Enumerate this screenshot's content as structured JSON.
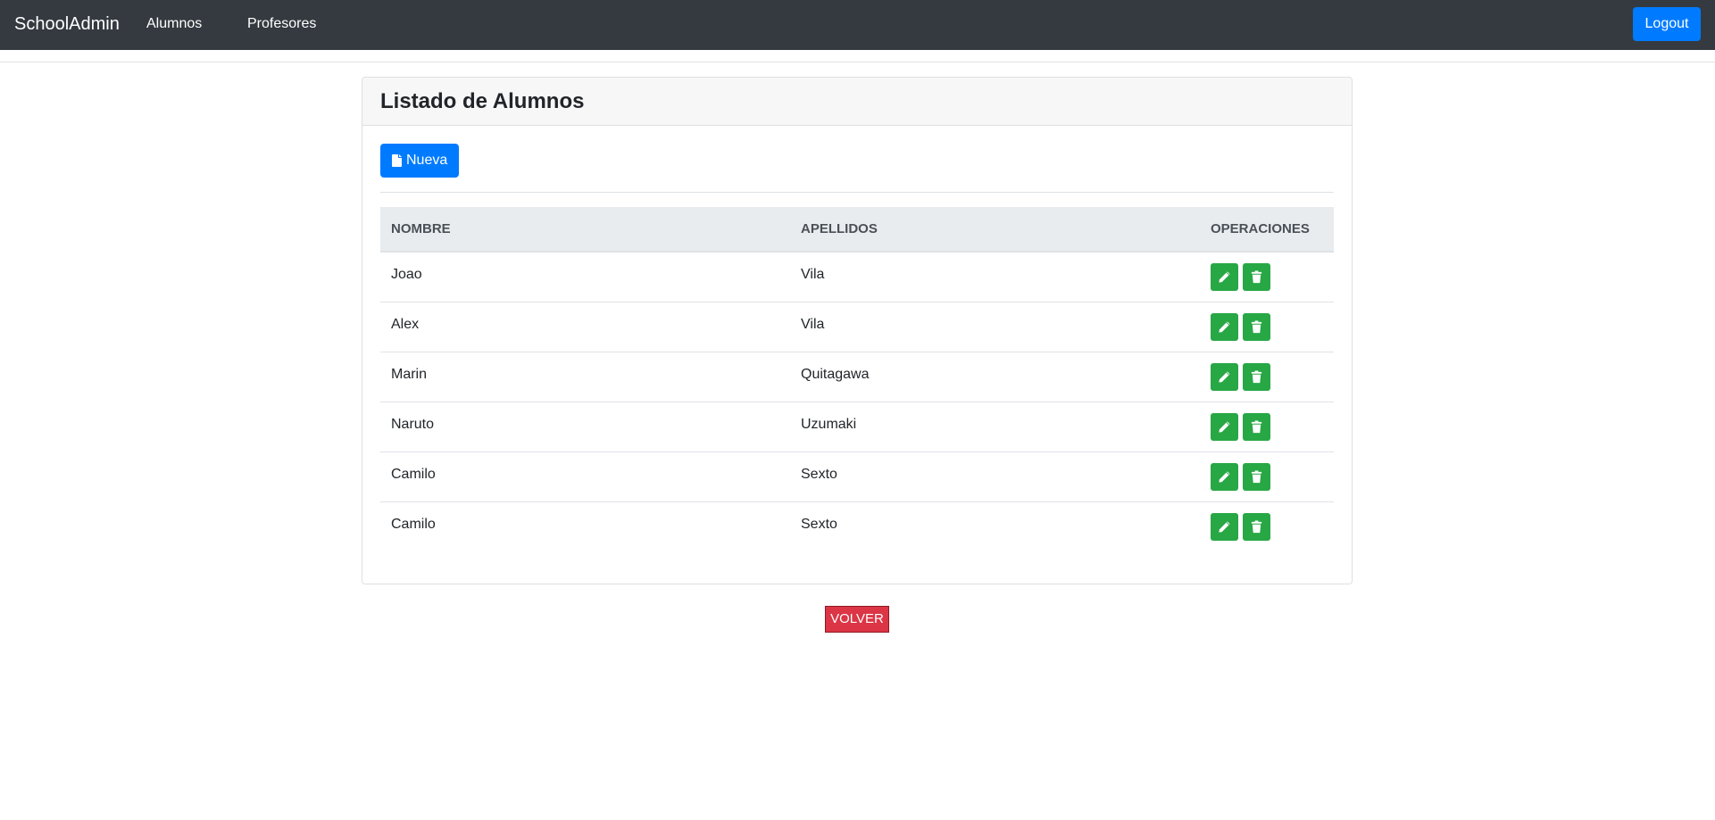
{
  "navbar": {
    "brand": "SchoolAdmin",
    "links": [
      "Alumnos",
      "Profesores"
    ],
    "logout_label": "Logout"
  },
  "card": {
    "title": "Listado de Alumnos",
    "new_button_label": "Nueva",
    "new_button_icon": "file-icon"
  },
  "table": {
    "headers": [
      "NOMBRE",
      "APELLIDOS",
      "OPERACIONES"
    ],
    "rows": [
      {
        "nombre": "Joao",
        "apellidos": "Vila"
      },
      {
        "nombre": "Alex",
        "apellidos": "Vila"
      },
      {
        "nombre": "Marin",
        "apellidos": "Quitagawa"
      },
      {
        "nombre": "Naruto",
        "apellidos": "Uzumaki"
      },
      {
        "nombre": "Camilo",
        "apellidos": "Sexto"
      },
      {
        "nombre": "Camilo",
        "apellidos": "Sexto"
      }
    ],
    "row_operation_icons": [
      "pencil-icon",
      "trash-icon"
    ]
  },
  "footer": {
    "back_button_label": "VOLVER"
  },
  "colors": {
    "navbar_bg": "#343a40",
    "primary": "#007bff",
    "success": "#28a745",
    "danger": "#dc3545",
    "table_header_bg": "#e9ecef",
    "card_header_bg": "#f7f7f7"
  }
}
